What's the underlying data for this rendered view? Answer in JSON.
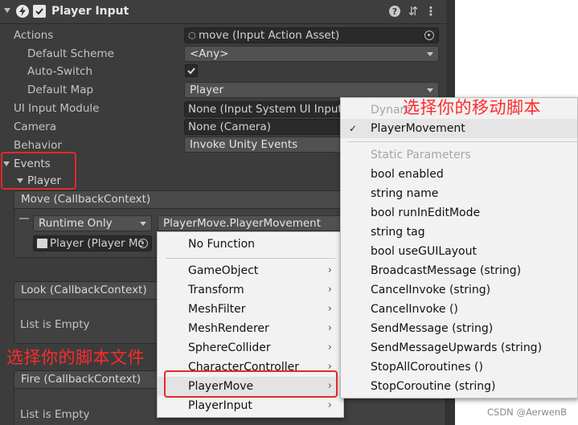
{
  "component": {
    "title": "Player Input",
    "enabled_checked": true
  },
  "fields": {
    "actions": {
      "label": "Actions",
      "value": "move (Input Action Asset)"
    },
    "default_scheme": {
      "label": "Default Scheme",
      "value": "<Any>"
    },
    "auto_switch": {
      "label": "Auto-Switch",
      "checked": true
    },
    "default_map": {
      "label": "Default Map",
      "value": "Player"
    },
    "ui_input_module": {
      "label": "UI Input Module",
      "value": "None (Input System UI Input M"
    },
    "camera": {
      "label": "Camera",
      "value": "None (Camera)"
    },
    "behavior": {
      "label": "Behavior",
      "value": "Invoke Unity Events"
    }
  },
  "events": {
    "label": "Events",
    "player_label": "Player",
    "move": {
      "header": "Move (CallbackContext)",
      "runtime": "Runtime Only",
      "function": "PlayerMove.PlayerMovement",
      "object": "Player (Player Mc"
    },
    "look": {
      "header": "Look (CallbackContext)",
      "empty": "List is Empty"
    },
    "fire": {
      "header": "Fire (CallbackContext)",
      "empty": "List is Empty"
    }
  },
  "component_menu": {
    "no_function": "No Function",
    "items": [
      "GameObject",
      "Transform",
      "MeshFilter",
      "MeshRenderer",
      "SphereCollider",
      "CharacterController",
      "PlayerMove",
      "PlayerInput"
    ],
    "highlighted": "PlayerMove"
  },
  "method_menu": {
    "dynamic_header": "Dynam",
    "selected": "PlayerMovement",
    "static_header": "Static Parameters",
    "items": [
      "bool enabled",
      "string name",
      "bool runInEditMode",
      "string tag",
      "bool useGUILayout",
      "BroadcastMessage (string)",
      "CancelInvoke (string)",
      "CancelInvoke ()",
      "SendMessage (string)",
      "SendMessageUpwards (string)",
      "StopAllCoroutines ()",
      "StopCoroutine (string)"
    ]
  },
  "annotations": {
    "select_move_script": "选择你的移动脚本",
    "select_script_file": "选择你的脚本文件"
  },
  "watermark": "CSDN @AerwenB",
  "colors": {
    "annotation": "#ff2b2b",
    "inspector_bg": "#3c3c3c",
    "menu_bg": "#f2f2f2"
  }
}
